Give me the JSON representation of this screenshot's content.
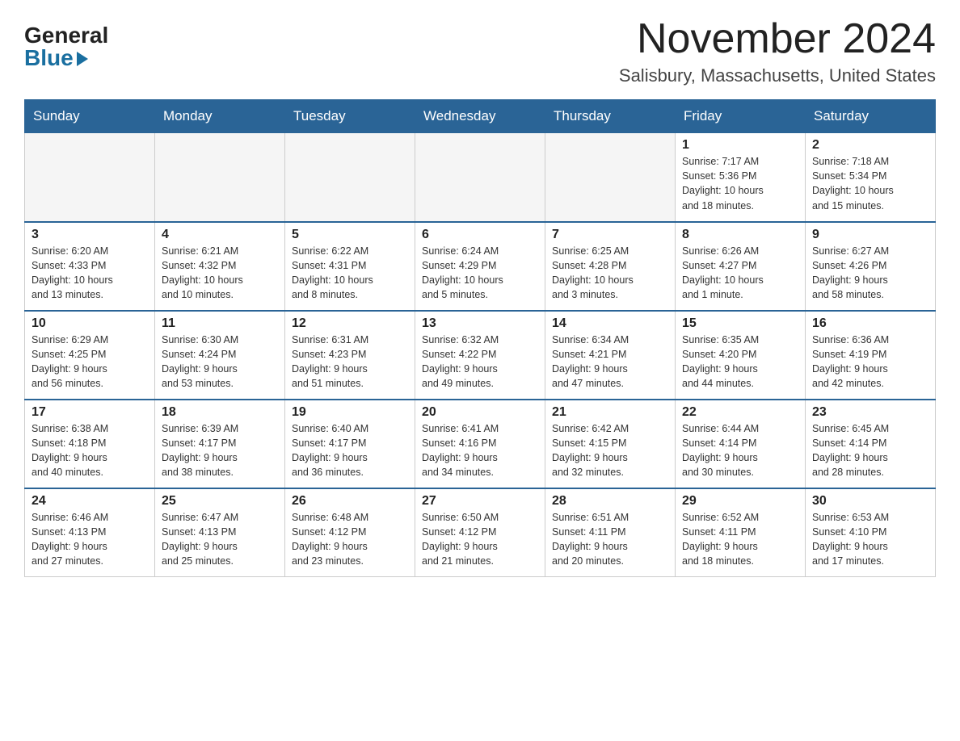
{
  "logo": {
    "general": "General",
    "blue": "Blue"
  },
  "header": {
    "month": "November 2024",
    "location": "Salisbury, Massachusetts, United States"
  },
  "weekdays": [
    "Sunday",
    "Monday",
    "Tuesday",
    "Wednesday",
    "Thursday",
    "Friday",
    "Saturday"
  ],
  "weeks": [
    [
      {
        "day": "",
        "info": "",
        "empty": true
      },
      {
        "day": "",
        "info": "",
        "empty": true
      },
      {
        "day": "",
        "info": "",
        "empty": true
      },
      {
        "day": "",
        "info": "",
        "empty": true
      },
      {
        "day": "",
        "info": "",
        "empty": true
      },
      {
        "day": "1",
        "info": "Sunrise: 7:17 AM\nSunset: 5:36 PM\nDaylight: 10 hours\nand 18 minutes."
      },
      {
        "day": "2",
        "info": "Sunrise: 7:18 AM\nSunset: 5:34 PM\nDaylight: 10 hours\nand 15 minutes."
      }
    ],
    [
      {
        "day": "3",
        "info": "Sunrise: 6:20 AM\nSunset: 4:33 PM\nDaylight: 10 hours\nand 13 minutes."
      },
      {
        "day": "4",
        "info": "Sunrise: 6:21 AM\nSunset: 4:32 PM\nDaylight: 10 hours\nand 10 minutes."
      },
      {
        "day": "5",
        "info": "Sunrise: 6:22 AM\nSunset: 4:31 PM\nDaylight: 10 hours\nand 8 minutes."
      },
      {
        "day": "6",
        "info": "Sunrise: 6:24 AM\nSunset: 4:29 PM\nDaylight: 10 hours\nand 5 minutes."
      },
      {
        "day": "7",
        "info": "Sunrise: 6:25 AM\nSunset: 4:28 PM\nDaylight: 10 hours\nand 3 minutes."
      },
      {
        "day": "8",
        "info": "Sunrise: 6:26 AM\nSunset: 4:27 PM\nDaylight: 10 hours\nand 1 minute."
      },
      {
        "day": "9",
        "info": "Sunrise: 6:27 AM\nSunset: 4:26 PM\nDaylight: 9 hours\nand 58 minutes."
      }
    ],
    [
      {
        "day": "10",
        "info": "Sunrise: 6:29 AM\nSunset: 4:25 PM\nDaylight: 9 hours\nand 56 minutes."
      },
      {
        "day": "11",
        "info": "Sunrise: 6:30 AM\nSunset: 4:24 PM\nDaylight: 9 hours\nand 53 minutes."
      },
      {
        "day": "12",
        "info": "Sunrise: 6:31 AM\nSunset: 4:23 PM\nDaylight: 9 hours\nand 51 minutes."
      },
      {
        "day": "13",
        "info": "Sunrise: 6:32 AM\nSunset: 4:22 PM\nDaylight: 9 hours\nand 49 minutes."
      },
      {
        "day": "14",
        "info": "Sunrise: 6:34 AM\nSunset: 4:21 PM\nDaylight: 9 hours\nand 47 minutes."
      },
      {
        "day": "15",
        "info": "Sunrise: 6:35 AM\nSunset: 4:20 PM\nDaylight: 9 hours\nand 44 minutes."
      },
      {
        "day": "16",
        "info": "Sunrise: 6:36 AM\nSunset: 4:19 PM\nDaylight: 9 hours\nand 42 minutes."
      }
    ],
    [
      {
        "day": "17",
        "info": "Sunrise: 6:38 AM\nSunset: 4:18 PM\nDaylight: 9 hours\nand 40 minutes."
      },
      {
        "day": "18",
        "info": "Sunrise: 6:39 AM\nSunset: 4:17 PM\nDaylight: 9 hours\nand 38 minutes."
      },
      {
        "day": "19",
        "info": "Sunrise: 6:40 AM\nSunset: 4:17 PM\nDaylight: 9 hours\nand 36 minutes."
      },
      {
        "day": "20",
        "info": "Sunrise: 6:41 AM\nSunset: 4:16 PM\nDaylight: 9 hours\nand 34 minutes."
      },
      {
        "day": "21",
        "info": "Sunrise: 6:42 AM\nSunset: 4:15 PM\nDaylight: 9 hours\nand 32 minutes."
      },
      {
        "day": "22",
        "info": "Sunrise: 6:44 AM\nSunset: 4:14 PM\nDaylight: 9 hours\nand 30 minutes."
      },
      {
        "day": "23",
        "info": "Sunrise: 6:45 AM\nSunset: 4:14 PM\nDaylight: 9 hours\nand 28 minutes."
      }
    ],
    [
      {
        "day": "24",
        "info": "Sunrise: 6:46 AM\nSunset: 4:13 PM\nDaylight: 9 hours\nand 27 minutes."
      },
      {
        "day": "25",
        "info": "Sunrise: 6:47 AM\nSunset: 4:13 PM\nDaylight: 9 hours\nand 25 minutes."
      },
      {
        "day": "26",
        "info": "Sunrise: 6:48 AM\nSunset: 4:12 PM\nDaylight: 9 hours\nand 23 minutes."
      },
      {
        "day": "27",
        "info": "Sunrise: 6:50 AM\nSunset: 4:12 PM\nDaylight: 9 hours\nand 21 minutes."
      },
      {
        "day": "28",
        "info": "Sunrise: 6:51 AM\nSunset: 4:11 PM\nDaylight: 9 hours\nand 20 minutes."
      },
      {
        "day": "29",
        "info": "Sunrise: 6:52 AM\nSunset: 4:11 PM\nDaylight: 9 hours\nand 18 minutes."
      },
      {
        "day": "30",
        "info": "Sunrise: 6:53 AM\nSunset: 4:10 PM\nDaylight: 9 hours\nand 17 minutes."
      }
    ]
  ]
}
